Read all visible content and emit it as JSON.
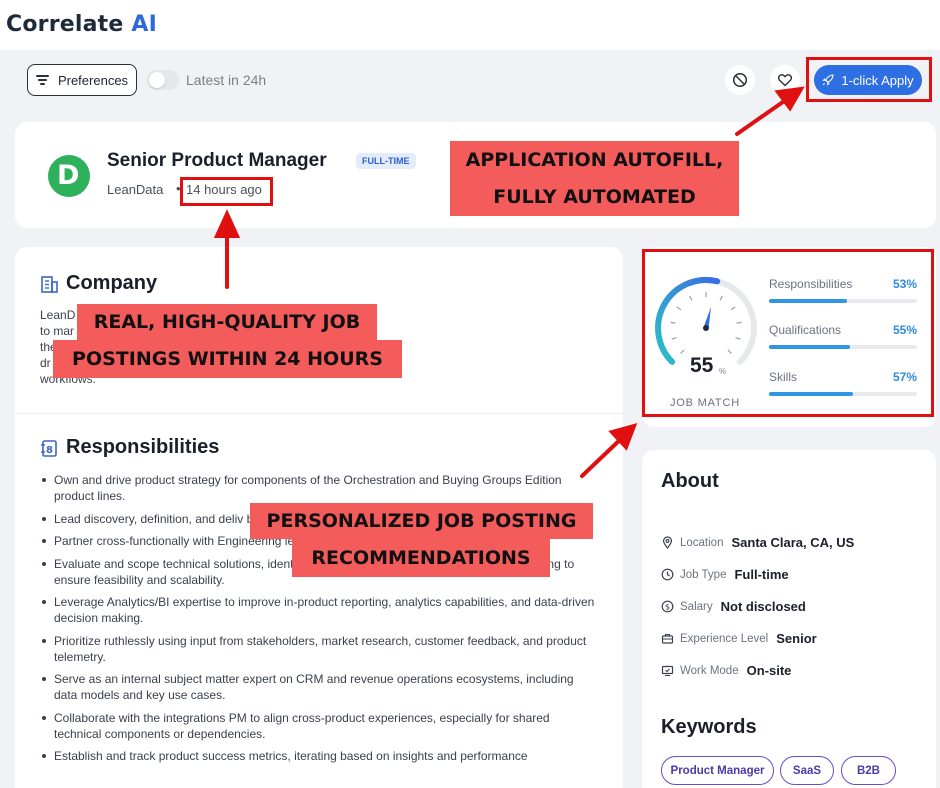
{
  "brand": {
    "prefix": "Correlate ",
    "suffix": "AI"
  },
  "toolbar": {
    "preferences_label": "Preferences",
    "latest_label": "Latest in 24h",
    "apply_label": "1-click Apply",
    "accent": "#2f6fe4"
  },
  "job": {
    "title": "Senior Product Manager",
    "type_badge": "FULL-TIME",
    "company": "LeanData",
    "separator": "•",
    "posted": "14 hours ago"
  },
  "company_section": {
    "heading": "Company",
    "lines": [
      "LeanD                                                                   ing, sales, customer, and partner ops)",
      "to mar                                                          mpowering these teams with the tools",
      "the                                                                  mplex revenue operations and",
      "dr                                                              grate seamlessly into existing",
      "workflows."
    ]
  },
  "responsibilities": {
    "heading": "Responsibilities",
    "items": [
      "Own and drive product strategy for components of the Orchestration and Buying Groups Edition product lines.",
      "Lead discovery, definition, and deliv business goals.",
      "Partner cross-functionally with Engineering                                                               les to execute the roadmap.",
      "Evaluate and scope technical solutions, identifying trade-offs and collaborating with engineering to ensure feasibility and scalability.",
      "Leverage Analytics/BI expertise to improve in-product reporting, analytics capabilities, and data-driven decision making.",
      "Prioritize ruthlessly using input from stakeholders, market research, customer feedback, and product telemetry.",
      "Serve as an internal subject matter expert on CRM and revenue operations ecosystems, including data models and key use cases.",
      "Collaborate with the integrations PM to align cross-product experiences, especially for shared technical components or dependencies.",
      "Establish and track product success metrics, iterating based on insights and performance"
    ]
  },
  "match": {
    "score": "55",
    "score_unit": "%",
    "score_fraction": 0.55,
    "label": "JOB MATCH",
    "metrics": [
      {
        "name": "Responsibilities",
        "value": "53%",
        "fraction": 0.53
      },
      {
        "name": "Qualifications",
        "value": "55%",
        "fraction": 0.55
      },
      {
        "name": "Skills",
        "value": "57%",
        "fraction": 0.57
      }
    ]
  },
  "about": {
    "heading": "About",
    "rows": [
      {
        "icon": "location-pin-icon",
        "label": "Location",
        "value": "Santa Clara, CA, US"
      },
      {
        "icon": "clock-icon",
        "label": "Job Type",
        "value": "Full-time"
      },
      {
        "icon": "dollar-icon",
        "label": "Salary",
        "value": "Not disclosed"
      },
      {
        "icon": "briefcase-icon",
        "label": "Experience Level",
        "value": "Senior"
      },
      {
        "icon": "monitor-icon",
        "label": "Work Mode",
        "value": "On-site"
      }
    ]
  },
  "keywords": {
    "heading": "Keywords",
    "chips": [
      "Product Manager",
      "SaaS",
      "B2B"
    ]
  },
  "callouts": {
    "autofill": [
      "APPLICATION AUTOFILL,",
      "FULLY AUTOMATED"
    ],
    "postings": [
      "REAL, HIGH-QUALITY JOB",
      "POSTINGS WITHIN  24 HOURS"
    ],
    "recommendations": [
      "PERSONALIZED JOB POSTING",
      "RECOMMENDATIONS"
    ],
    "color": "#f45b5b",
    "border_color": "#e01010"
  }
}
